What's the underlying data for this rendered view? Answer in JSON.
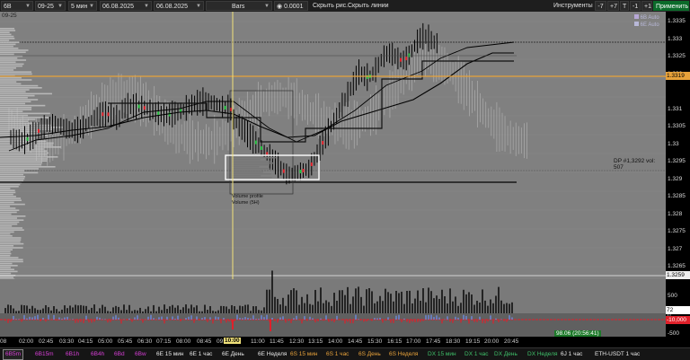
{
  "toolbar": {
    "symbol": "6B",
    "expiry": "09-25",
    "timeframe": "5 мин",
    "date_from": "06.08.2025",
    "date_to": "06.08.2025",
    "chart_type": "Bars",
    "tick_size": "0.0001",
    "hide_drawings": "Скрыть рис.",
    "hide_lines": "Скрыть линии",
    "tools": "Инструменты",
    "btn_minus7": "-7",
    "btn_plus7": "+7",
    "btn_t": "T",
    "btn_minus1": "-1",
    "btn_plus1": "+1",
    "apply": "Применить"
  },
  "chart": {
    "contract_label": "09-25",
    "legend": [
      "6B Auto",
      "6E Auto"
    ],
    "dp_label": "DP #1,3292 vol: 507",
    "vp_label_1": "Volume profile",
    "vp_label_2": "Volume (5H)",
    "delta_value": "98.06 (20:56:41)"
  },
  "price_axis": {
    "ticks": [
      {
        "label": "1.3335",
        "price": 1.3335
      },
      {
        "label": "1.333",
        "price": 1.333
      },
      {
        "label": "1.3325",
        "price": 1.3325
      },
      {
        "label": "1.332",
        "price": 1.332
      },
      {
        "label": "1.331",
        "price": 1.331
      },
      {
        "label": "1.3305",
        "price": 1.3305
      },
      {
        "label": "1.33",
        "price": 1.33
      },
      {
        "label": "1.3295",
        "price": 1.3295
      },
      {
        "label": "1.329",
        "price": 1.329
      },
      {
        "label": "1.3285",
        "price": 1.3285
      },
      {
        "label": "1.328",
        "price": 1.328
      },
      {
        "label": "1.3275",
        "price": 1.3275
      },
      {
        "label": "1.327",
        "price": 1.327
      },
      {
        "label": "1.3265",
        "price": 1.3265
      }
    ],
    "current_price": "1.3319",
    "low_price": "1.3259",
    "volume_ticks": [
      "500",
      "0"
    ],
    "volume_current": "72",
    "delta_current": "-10,000",
    "delta_tick": "-500"
  },
  "time_axis": {
    "labels": [
      "08",
      "02:00",
      "02:45",
      "03:30",
      "04:15",
      "05:00",
      "05:45",
      "06:30",
      "07:15",
      "08:00",
      "08:45",
      "09:30",
      "10:00",
      "11:00",
      "11:45",
      "12:30",
      "13:15",
      "14:00",
      "14:45",
      "15:30",
      "16:15",
      "17:00",
      "17:45",
      "18:30",
      "19:15",
      "20:00",
      "20:45"
    ],
    "highlight": "10:00"
  },
  "tabs": [
    {
      "label": "6B5m",
      "color": "#d63fd6",
      "active": true
    },
    {
      "label": "6B15m",
      "color": "#d63fd6"
    },
    {
      "label": "6B1h",
      "color": "#d63fd6"
    },
    {
      "label": "6B4h",
      "color": "#d63fd6"
    },
    {
      "label": "6Bd",
      "color": "#d63fd6"
    },
    {
      "label": "6Bw",
      "color": "#d63fd6"
    },
    {
      "label": "6E 15 мин",
      "color": "#e8e8e8"
    },
    {
      "label": "6E 1 час",
      "color": "#e8e8e8"
    },
    {
      "label": "6E День",
      "color": "#e8e8e8"
    },
    {
      "label": "6E Неделя",
      "color": "#e8e8e8"
    },
    {
      "label": "6S 15 мин",
      "color": "#e8a23a"
    },
    {
      "label": "6S 1 час",
      "color": "#e8a23a"
    },
    {
      "label": "6S День",
      "color": "#e8a23a"
    },
    {
      "label": "6S Неделя",
      "color": "#e8a23a"
    },
    {
      "label": "DX 15 мин",
      "color": "#3fc06a"
    },
    {
      "label": "DX 1 час",
      "color": "#3fc06a"
    },
    {
      "label": "DX День",
      "color": "#3fc06a"
    },
    {
      "label": "DX Неделя",
      "color": "#3fc06a"
    },
    {
      "label": "6J 1 час",
      "color": "#e8e8e8"
    },
    {
      "label": "ETH-USDT 1 час",
      "color": "#e8e8e8"
    }
  ],
  "colors": {
    "chart_bg": "#808080",
    "bar": "#000000",
    "up": "#1fbf3a",
    "down": "#e0202a",
    "level_orange": "#e8a23a",
    "cursor_yellow": "#f2e27a",
    "delta_blue": "#6f8ff2"
  }
}
